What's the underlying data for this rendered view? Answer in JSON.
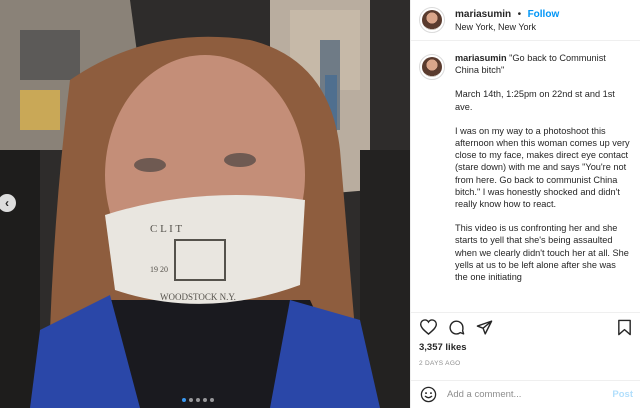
{
  "media": {
    "nav_arrow": "‹",
    "carousel_dots": 5,
    "active_dot": 1,
    "mask_text_top": "C   L        I   T",
    "mask_text_year": "19      20",
    "mask_text_bottom": "WOODSTOCK N.Y."
  },
  "header": {
    "username": "mariasumin",
    "separator": "•",
    "follow_label": "Follow",
    "location": "New York, New York"
  },
  "caption": {
    "username": "mariasumin",
    "title": "\"Go back to Communist China bitch\"",
    "paragraphs": [
      "March 14th, 1:25pm on 22nd st and 1st ave.",
      "I was on my way to a photoshoot this afternoon when this woman comes up very close to my face, makes direct eye contact (stare down) with me and says \"You're not from here. Go back to communist China bitch.\" I was honestly shocked and didn't really know how to react.",
      "This video is us confronting her and she starts to yell that she's being assaulted when we clearly didn't touch her at all. She yells at us to be left alone after she was the one initiating"
    ]
  },
  "actions": {
    "icons": [
      "heart-icon",
      "comment-icon",
      "share-icon",
      "bookmark-icon"
    ],
    "likes": "3,357 likes",
    "date": "2 DAYS AGO"
  },
  "comment": {
    "placeholder": "Add a comment...",
    "post_label": "Post"
  },
  "colors": {
    "accent": "#0095f6",
    "post_disabled": "#b2dffc",
    "muted": "#8e8e8e",
    "border": "#efefef"
  }
}
